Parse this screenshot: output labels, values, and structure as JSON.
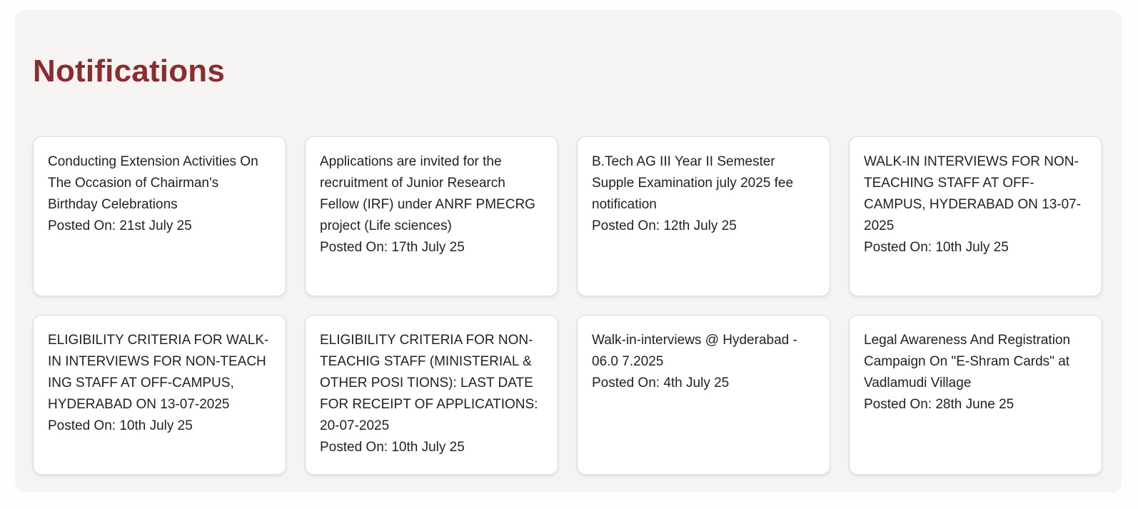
{
  "section": {
    "title": "Notifications"
  },
  "notifications": [
    {
      "title": "Conducting Extension Activities On The Occasion of Chairman's Birthday Celebrations",
      "posted": "Posted On: 21st July 25"
    },
    {
      "title": "Applications are invited for the recruitment of Junior Research Fellow (IRF) under ANRF PMECRG project (Life sciences)",
      "posted": "Posted On: 17th July 25"
    },
    {
      "title": "B.Tech AG III Year II Semester Supple Examination july 2025 fee notification",
      "posted": "Posted On: 12th July 25"
    },
    {
      "title": "WALK-IN INTERVIEWS FOR NON-TEACHING STAFF AT OFF-CAMPUS, HYDERABAD ON 13-07-2025",
      "posted": "Posted On: 10th July 25"
    },
    {
      "title": "ELIGIBILITY CRITERIA FOR WALK-IN INTERVIEWS FOR NON-TEACH ING STAFF AT OFF-CAMPUS, HYDERABAD ON 13-07-2025",
      "posted": "Posted On: 10th July 25"
    },
    {
      "title": "ELIGIBILITY CRITERIA FOR NON-TEACHIG STAFF (MINISTERIAL & OTHER POSI TIONS): LAST DATE FOR RECEIPT OF APPLICATIONS: 20-07-2025",
      "posted": "Posted On: 10th July 25"
    },
    {
      "title": "Walk-in-interviews @ Hyderabad - 06.0 7.2025",
      "posted": "Posted On: 4th July 25"
    },
    {
      "title": "Legal Awareness And Registration Campaign On \"E-Shram Cards\" at Vadlamudi Village",
      "posted": "Posted On: 28th June 25"
    }
  ]
}
